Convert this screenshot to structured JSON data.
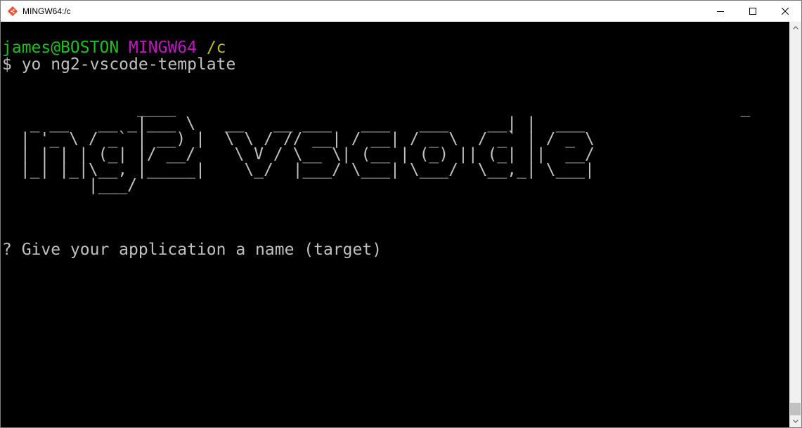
{
  "window": {
    "title": "MINGW64:/c"
  },
  "terminal": {
    "prompt": {
      "user_host": "james@BOSTON",
      "system": "MINGW64",
      "path": "/c"
    },
    "command_line": "$ yo ng2-vscode-template",
    "ascii_banner": "             ____                                                          _\n  _ __   __ _|___ \\   __   __ ___   ___   ___    __| |  ___\n | '_ \\ / _` | __) |  \\ \\ / // __| / __| / _ \\  / _` | / _ \\\n | | | | (_| |/ __/    \\ V / \\__ \\| (__ | (_) || (_| ||  __/\n |_| |_|\\__, |_____|    \\_/  |___/ \\___| \\___/  \\__,_| \\___|\n        |___/",
    "question": "? Give your application a name (target)"
  },
  "icons": {
    "app": "git-diamond-icon",
    "minimize": "minimize-icon",
    "maximize": "maximize-icon",
    "close": "close-icon",
    "scroll_up": "scroll-up-arrow-icon",
    "scroll_down": "scroll-down-arrow-icon"
  },
  "colors": {
    "background": "#000000",
    "prompt_user": "#1cc01c",
    "prompt_system": "#c014c0",
    "prompt_path": "#c0c010",
    "text": "#c0c0c0",
    "git_icon": "#f05033"
  }
}
